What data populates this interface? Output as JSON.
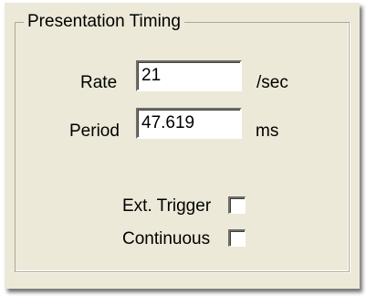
{
  "group": {
    "title": "Presentation Timing"
  },
  "rate": {
    "label": "Rate",
    "value": "21",
    "unit": "/sec"
  },
  "period": {
    "label": "Period",
    "value": "47.619",
    "unit": "ms"
  },
  "ext_trigger": {
    "label": "Ext. Trigger",
    "checked": false
  },
  "continuous": {
    "label": "Continuous",
    "checked": false
  },
  "colors": {
    "panel_bg": "#ece9d8",
    "groupbox_border": "#aca899"
  }
}
